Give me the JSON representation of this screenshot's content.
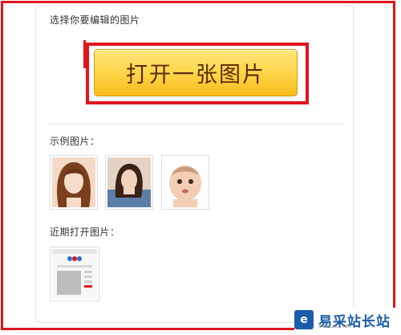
{
  "header": {
    "prompt": "选择你要编辑的图片"
  },
  "open_button": {
    "label": "打开一张图片"
  },
  "sample": {
    "label": "示例图片：",
    "thumbnails": [
      "woman-portrait",
      "woman-selfie",
      "baby-photo"
    ]
  },
  "recent": {
    "label": "近期打开图片："
  },
  "watermark": {
    "logo": "e",
    "text": "易采站长站",
    "url": "www.Easck.Com"
  },
  "colors": {
    "highlight": "#e0151d",
    "button_top": "#ffe680",
    "button_bottom": "#f9bb1c",
    "button_text": "#5a2d08",
    "watermark": "#1b5ca8"
  }
}
